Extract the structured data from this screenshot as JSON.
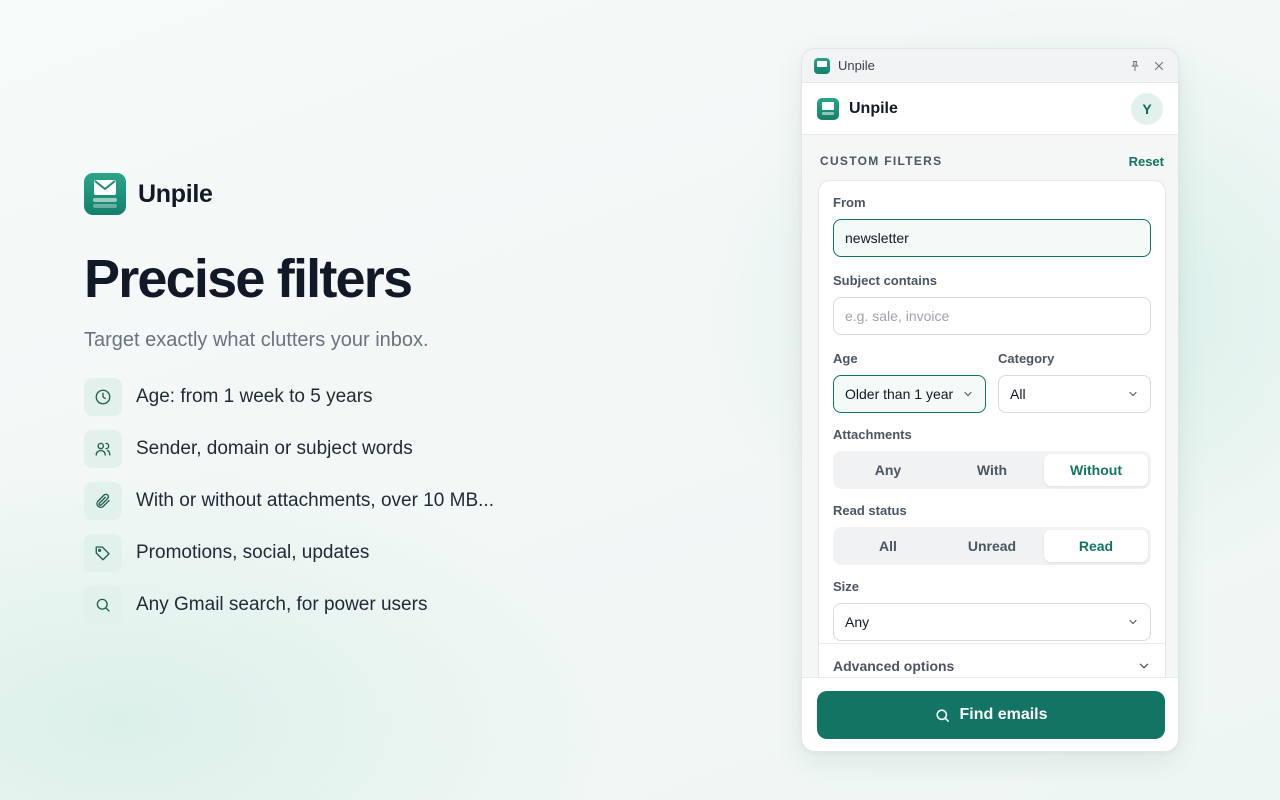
{
  "hero": {
    "brand_name": "Unpile",
    "headline": "Precise filters",
    "subline": "Target exactly what clutters your inbox.",
    "features": [
      {
        "icon": "clock-icon",
        "text": "Age: from 1 week to 5 years"
      },
      {
        "icon": "users-icon",
        "text": "Sender, domain or subject words"
      },
      {
        "icon": "paperclip-icon",
        "text": "With or without attachments, over 10 MB..."
      },
      {
        "icon": "tag-icon",
        "text": "Promotions, social, updates"
      },
      {
        "icon": "search-icon",
        "text": "Any Gmail search, for power users"
      }
    ]
  },
  "window": {
    "title": "Unpile",
    "app_name": "Unpile",
    "avatar_initial": "Y"
  },
  "filters": {
    "section_title": "CUSTOM FILTERS",
    "reset_label": "Reset",
    "from": {
      "label": "From",
      "value": "newsletter"
    },
    "subject": {
      "label": "Subject contains",
      "placeholder": "e.g. sale, invoice",
      "value": ""
    },
    "age": {
      "label": "Age",
      "value": "Older than 1 year"
    },
    "category": {
      "label": "Category",
      "value": "All"
    },
    "attachments": {
      "label": "Attachments",
      "options": [
        "Any",
        "With",
        "Without"
      ],
      "selected": "Without"
    },
    "read_status": {
      "label": "Read status",
      "options": [
        "All",
        "Unread",
        "Read"
      ],
      "selected": "Read"
    },
    "size": {
      "label": "Size",
      "value": "Any"
    },
    "advanced_label": "Advanced options"
  },
  "footer": {
    "find_label": "Find emails"
  },
  "colors": {
    "accent": "#127563",
    "accent_light": "#e3f1ed"
  }
}
